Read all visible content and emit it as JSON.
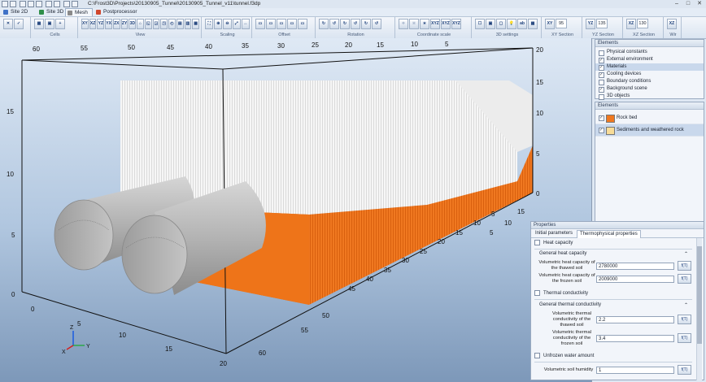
{
  "window": {
    "path": "C:\\Frost3D\\Projects\\20130905_Tunnel\\20130905_Tunnel_v11\\tunnel.f3dp",
    "minimize": "–",
    "maximize": "□",
    "close": "✕"
  },
  "tabs": [
    {
      "label": "Site 2D",
      "icon": "site-2d-icon",
      "color": "#3f72c7"
    },
    {
      "label": "Site 3D",
      "icon": "site-3d-icon",
      "color": "#2f8f4a"
    },
    {
      "label": "Mesh",
      "icon": "mesh-icon",
      "color": "#8a8a8a"
    },
    {
      "label": "Postprocessor",
      "icon": "postprocessor-icon",
      "color": "#d0472e"
    }
  ],
  "ribbon": {
    "groups": [
      {
        "label": "",
        "buttons": [
          "✕",
          "✓"
        ]
      },
      {
        "label": "Cells",
        "buttons": [
          "▦",
          "▣",
          "+"
        ]
      },
      {
        "label": "View",
        "buttons": [
          "XY",
          "XZ",
          "YZ",
          "YX",
          "ZX",
          "ZY",
          "3D",
          "⌂",
          "◱",
          "◲",
          "◳",
          "◴",
          "▤",
          "▥",
          "▦"
        ]
      },
      {
        "label": "Scaling",
        "buttons": [
          "⛶",
          "⊕",
          "⊖",
          "⤢",
          "↔"
        ]
      },
      {
        "label": "Offset",
        "buttons": [
          "▭",
          "▭",
          "▭",
          "▭",
          "▭"
        ]
      },
      {
        "label": "Rotation",
        "buttons": [
          "↻",
          "↺",
          "↻",
          "↺",
          "↻",
          "↺"
        ]
      },
      {
        "label": "Coordinate scale",
        "buttons": [
          "⁘",
          "⁙",
          "∗",
          "XYZ",
          "XYZ",
          "XYZ"
        ]
      },
      {
        "label": "3D settings",
        "buttons": [
          "☐",
          "▣",
          "▢",
          "💡",
          "ab",
          "▦"
        ]
      },
      {
        "label": "XY Section",
        "buttons": [
          "XY"
        ],
        "value": "95"
      },
      {
        "label": "YZ Section",
        "buttons": [
          "YZ"
        ],
        "value": "135"
      },
      {
        "label": "XZ Section",
        "buttons": [
          "XZ"
        ],
        "value": "130"
      },
      {
        "label": "Wir",
        "buttons": [
          "XZ"
        ]
      }
    ]
  },
  "axes": {
    "top_x": [
      "60",
      "55",
      "50",
      "45",
      "40",
      "35",
      "30",
      "25",
      "20",
      "15",
      "10",
      "5"
    ],
    "left_y": [
      "15",
      "10",
      "5",
      "0"
    ],
    "right_z": [
      "20",
      "15",
      "10",
      "5",
      "0"
    ],
    "right_front": [
      "15",
      "10",
      "5"
    ],
    "bottom_x": [
      "0",
      "5",
      "10",
      "15",
      "20"
    ],
    "bottom_depth": [
      "5",
      "10",
      "15",
      "20",
      "25",
      "30",
      "35",
      "40",
      "45",
      "50",
      "55",
      "60"
    ],
    "triad": {
      "z": "Z",
      "y": "Y",
      "x": "X"
    }
  },
  "elements_panel_top": {
    "title": "Elements",
    "items": [
      {
        "label": "Physical constants",
        "check": false,
        "selected": false
      },
      {
        "label": "External environment",
        "check": true,
        "selected": false
      },
      {
        "label": "Materials",
        "check": true,
        "selected": true
      },
      {
        "label": "Cooling devices",
        "check": true,
        "selected": false
      },
      {
        "label": "Boundary conditions",
        "check": false,
        "selected": false
      },
      {
        "label": "Background scene",
        "check": true,
        "selected": false
      },
      {
        "label": "3D objects",
        "check": false,
        "selected": false
      }
    ]
  },
  "elements_panel": {
    "title": "Elements",
    "items": [
      {
        "label": "Rock bed",
        "color": "#f07820",
        "selected": false
      },
      {
        "label": "Sediments and weathered rock",
        "color": "#f8dc98",
        "selected": true
      }
    ]
  },
  "properties": {
    "title": "Properties",
    "tabs": [
      "Initial parameters",
      "Thermophysical properties"
    ],
    "heat_capacity": {
      "section": "Heat capacity",
      "subsection": "General heat capacity",
      "thawed_label": "Volumetric heat capacity of the thawed soil",
      "thawed_value": "2780000",
      "frozen_label": "Volumetric heat capacity of the frozen soil",
      "frozen_value": "2009000"
    },
    "thermal_conductivity": {
      "section": "Thermal conductivity",
      "subsection": "General thermal conductivity",
      "thawed_label": "Volumetric thermal conductivity of the thawed soil",
      "thawed_value": "2.2",
      "frozen_label": "Volumetric thermal conductivity of the frozen soil",
      "frozen_value": "3.4"
    },
    "unfrozen_water": {
      "section": "Unfrozen water amount",
      "humidity_label": "Volumetric soil humidity",
      "humidity_value": "1"
    },
    "button_label": "f(T)"
  },
  "colors": {
    "rock_bed": "#f07820",
    "sediment_top": "#f4f4f4",
    "tunnel": "#b4b4b4"
  }
}
